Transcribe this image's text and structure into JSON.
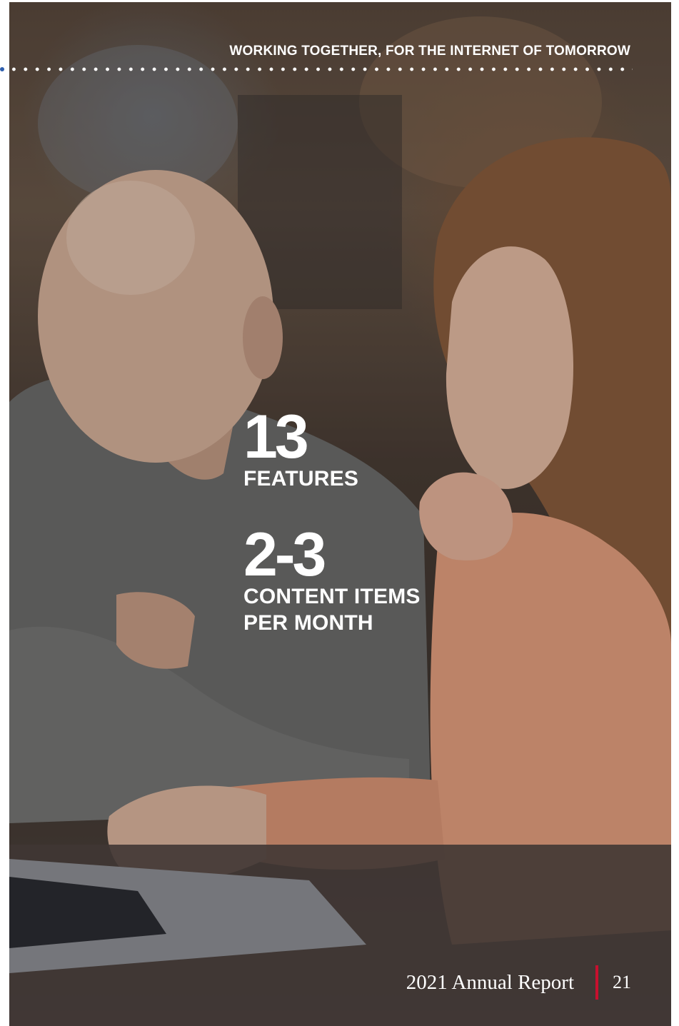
{
  "header": {
    "tagline": "WORKING TOGETHER, FOR THE INTERNET OF TOMORROW"
  },
  "stats": [
    {
      "value": "13",
      "label_lines": [
        "FEATURES"
      ]
    },
    {
      "value": "2-3",
      "label_lines": [
        "CONTENT ITEMS",
        "PER MONTH"
      ]
    }
  ],
  "footer": {
    "report_title": "2021 Annual Report",
    "page_number": "21"
  },
  "colors": {
    "accent_red": "#c8102e",
    "rule_blue": "#2f5fae",
    "text": "#ffffff"
  }
}
